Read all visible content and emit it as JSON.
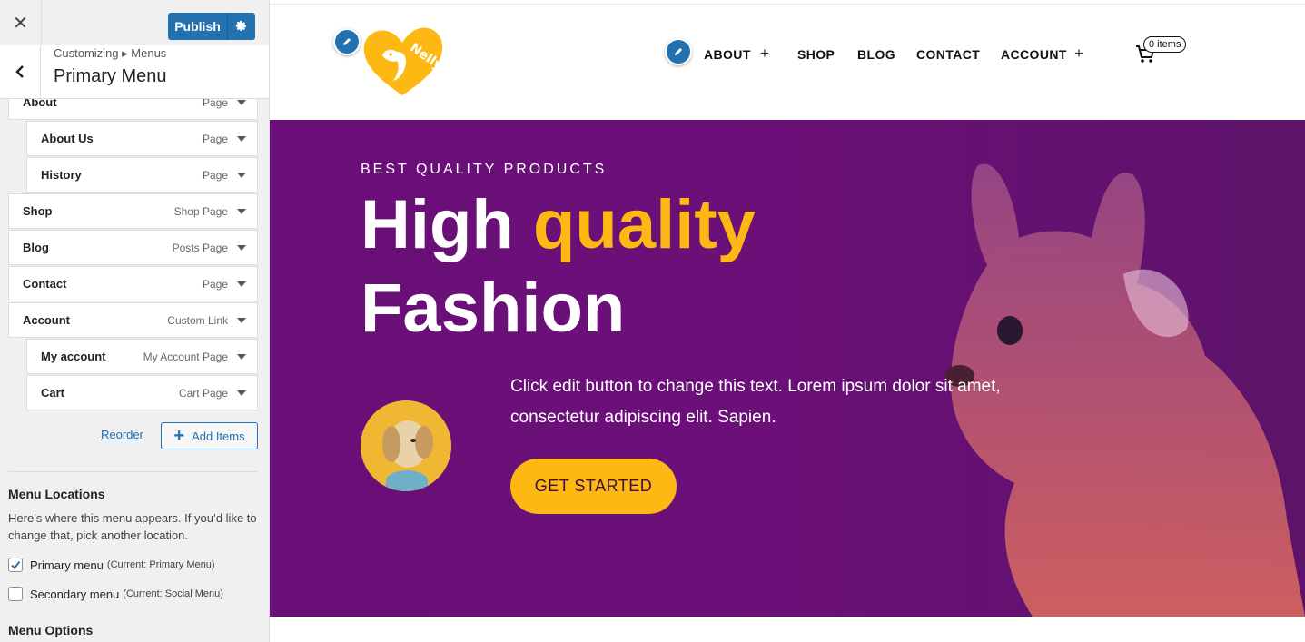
{
  "sidebar": {
    "publish_label": "Publish",
    "breadcrumb": "Customizing ▸ Menus",
    "section_title": "Primary Menu",
    "menu_items": [
      {
        "title": "About",
        "type": "Page"
      },
      {
        "title": "About Us",
        "type": "Page"
      },
      {
        "title": "History",
        "type": "Page"
      },
      {
        "title": "Shop",
        "type": "Shop Page"
      },
      {
        "title": "Blog",
        "type": "Posts Page"
      },
      {
        "title": "Contact",
        "type": "Page"
      },
      {
        "title": "Account",
        "type": "Custom Link"
      },
      {
        "title": "My account",
        "type": "My Account Page"
      },
      {
        "title": "Cart",
        "type": "Cart Page"
      }
    ],
    "reorder_label": "Reorder",
    "add_items_label": "Add Items",
    "locations_heading": "Menu Locations",
    "locations_desc": "Here’s where this menu appears. If you’d like to change that, pick another location.",
    "locations": [
      {
        "label": "Primary menu",
        "current": "(Current: Primary Menu)",
        "checked": true
      },
      {
        "label": "Secondary menu",
        "current": "(Current: Social Menu)",
        "checked": false
      }
    ],
    "options_heading": "Menu Options"
  },
  "preview": {
    "nav": [
      {
        "label": "ABOUT"
      },
      {
        "label": "SHOP"
      },
      {
        "label": "BLOG"
      },
      {
        "label": "CONTACT"
      },
      {
        "label": "ACCOUNT"
      }
    ],
    "nav_submenu_glyph": "+",
    "cart_count": "0 items",
    "logo_text": "Nelly",
    "hero": {
      "eyebrow": "BEST QUALITY PRODUCTS",
      "title_part1": "High",
      "title_accent": "quality",
      "title_line2": "Fashion",
      "body": "Click edit button to change this text. Lorem ipsum dolor sit amet, consectetur adipiscing elit. Sapien.",
      "cta": "GET STARTED"
    }
  },
  "colors": {
    "wp_blue": "#2271b1",
    "hero_purple": "#6a0f78",
    "accent_yellow": "#fdb813"
  },
  "icons": [
    "close-icon",
    "gear-icon",
    "chevron-left-icon",
    "chevron-down-icon",
    "plus-icon",
    "pencil-icon",
    "cart-icon",
    "checkmark-icon"
  ]
}
